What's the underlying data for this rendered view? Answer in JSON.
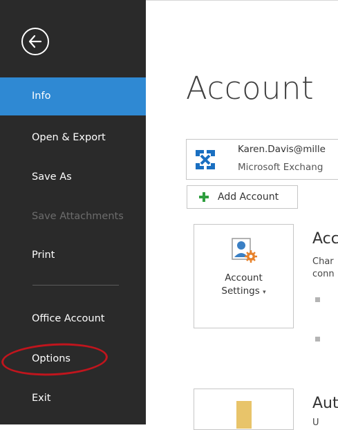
{
  "sidebar": {
    "back_icon": "back-arrow-icon",
    "items": [
      {
        "label": "Info",
        "selected": true
      },
      {
        "label": "Open & Export"
      },
      {
        "label": "Save As"
      },
      {
        "label": "Save Attachments",
        "disabled": true
      },
      {
        "label": "Print"
      },
      {
        "label": "Office Account"
      },
      {
        "label": "Options"
      },
      {
        "label": "Exit"
      }
    ],
    "colors": {
      "background": "#2a2a2a",
      "selected": "#2f89d3",
      "annotation": "#c0151d"
    }
  },
  "main": {
    "title": "Account",
    "account": {
      "email": "Karen.Davis@mille",
      "type": "Microsoft Exchang",
      "icon": "exchange-icon"
    },
    "add_account_label": "Add Account",
    "settings_tile": {
      "label_line1": "Account",
      "label_line2": "Settings",
      "caret": "▾"
    },
    "section1": {
      "title": "Acc",
      "desc_line1": "Char",
      "desc_line2": "conn"
    },
    "section2": {
      "title": "Aut",
      "desc": "U"
    }
  }
}
